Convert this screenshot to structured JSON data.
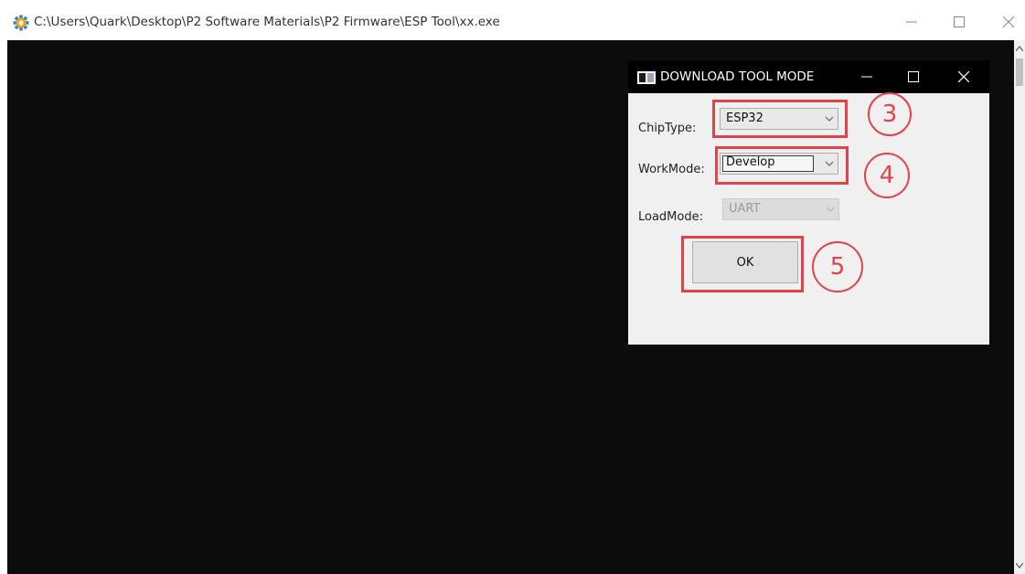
{
  "console": {
    "title": "C:\\Users\\Quark\\Desktop\\P2 Software Materials\\P2 Firmware\\ESP Tool\\xx.exe",
    "icon": "gear-icon"
  },
  "dialog": {
    "title": "DOWNLOAD TOOL MODE",
    "chip_type": {
      "label": "ChipType:",
      "value": "ESP32"
    },
    "work_mode": {
      "label": "WorkMode:",
      "value": "Develop"
    },
    "load_mode": {
      "label": "LoadMode:",
      "value": "UART",
      "disabled": true
    },
    "ok_label": "OK"
  },
  "annotations": {
    "step3": "3",
    "step4": "4",
    "step5": "5",
    "color": "#e2424a"
  }
}
